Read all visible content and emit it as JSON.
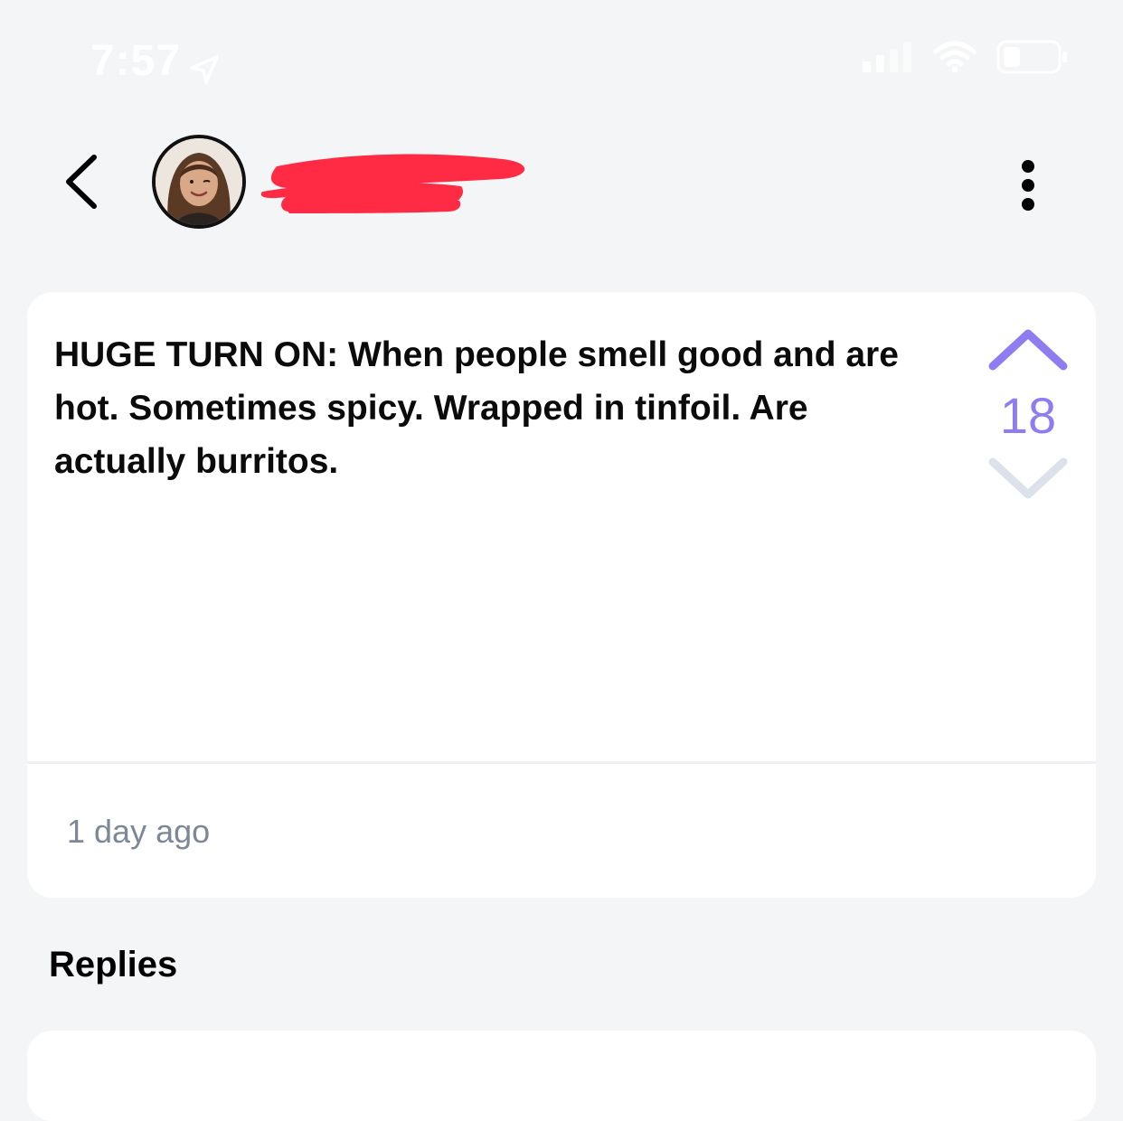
{
  "status_bar": {
    "time": "7:57",
    "icons": [
      "location-arrow-icon",
      "cellular-signal-icon",
      "wifi-icon",
      "battery-icon"
    ]
  },
  "header": {
    "back_icon": "chevron-left-icon",
    "username": "",
    "more_icon": "vertical-ellipsis-icon"
  },
  "post": {
    "text": "HUGE TURN ON: When people smell good and are hot. Sometimes spicy. Wrapped in tinfoil. Are actually burritos.",
    "vote_count": "18",
    "timestamp": "1 day ago"
  },
  "replies": {
    "heading": "Replies"
  },
  "colors": {
    "background": "#f4f5f7",
    "card": "#ffffff",
    "accent_purple": "#8e7cf0",
    "downvote_inactive": "#dde2ea",
    "timestamp_gray": "#7d8797",
    "redaction_red": "#ff2b45"
  }
}
